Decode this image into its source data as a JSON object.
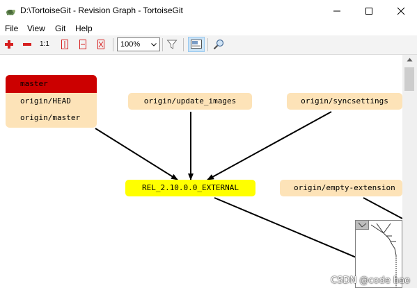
{
  "window": {
    "title": "D:\\TortoiseGit - Revision Graph - TortoiseGit"
  },
  "menu": {
    "items": [
      "File",
      "View",
      "Git",
      "Help"
    ]
  },
  "toolbar": {
    "one_to_one_label": "1:1",
    "zoom_value": "100%"
  },
  "graph": {
    "group_labels": [
      "master",
      "origin/HEAD",
      "origin/master"
    ],
    "update_images": "origin/update_images",
    "syncsettings": "origin/syncsettings",
    "tag_label": "REL_2.10.0.0_EXTERNAL",
    "empty_extension": "origin/empty-extension"
  },
  "colors": {
    "master_bg": "#cc0000",
    "branch_bg": "#fde3b8",
    "tag_bg": "#ffff00"
  },
  "watermark": "CSDN @code hao"
}
